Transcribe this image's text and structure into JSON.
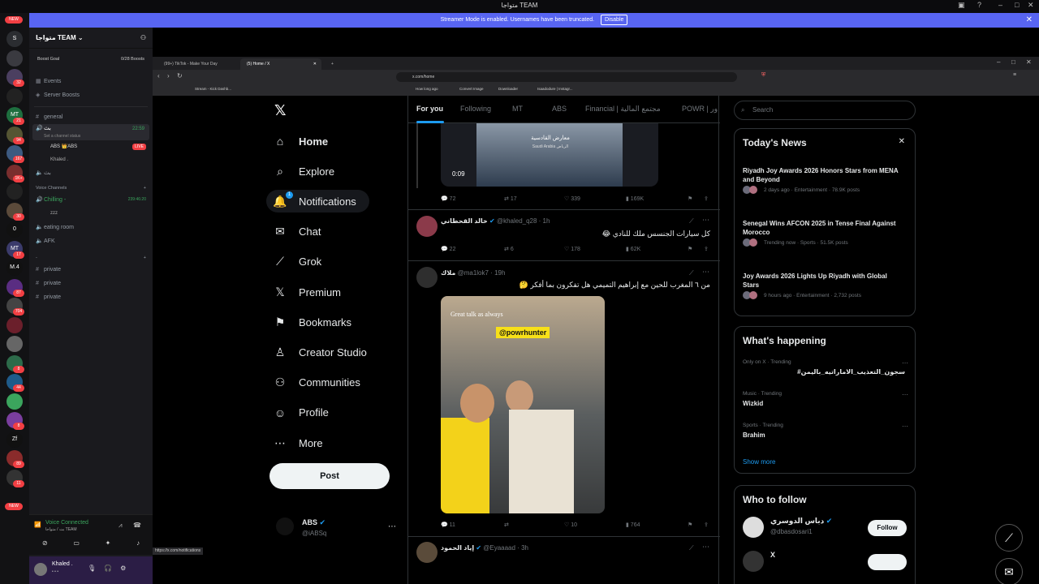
{
  "window": {
    "title": "متواجا TEAM"
  },
  "streamer_banner": {
    "text": "Streamer Mode is enabled. Usernames have been truncated.",
    "button": "Disable"
  },
  "rail": {
    "new_badge": "NEW",
    "items": [
      {
        "label": "S"
      },
      {
        "label": ""
      },
      {
        "label": "",
        "badge": "32"
      },
      {
        "label": ""
      },
      {
        "label": "MT",
        "badge": "21"
      },
      {
        "label": "",
        "badge": "94"
      },
      {
        "label": "",
        "badge": "167"
      },
      {
        "label": "",
        "badge": "1K+"
      },
      {
        "label": ""
      },
      {
        "label": "",
        "badge": "30"
      },
      {
        "label": "0"
      },
      {
        "label": "MT",
        "badge": "17"
      },
      {
        "label": "M.4"
      },
      {
        "label": "",
        "badge": "87"
      },
      {
        "label": "",
        "badge": "704"
      },
      {
        "label": ""
      },
      {
        "label": ""
      },
      {
        "label": "",
        "badge": "8"
      },
      {
        "label": "",
        "badge": "44"
      },
      {
        "label": ""
      },
      {
        "label": "",
        "badge": "8"
      },
      {
        "label": "Zf"
      },
      {
        "label": "",
        "badge": "89"
      },
      {
        "label": "",
        "badge": "11"
      }
    ],
    "new_badge_bottom": "NEW"
  },
  "discord": {
    "server_name": "متواجا TEAM",
    "boost_goal": "Boost Goal",
    "boost_count": "0/28 Boosts",
    "channels_top": [
      {
        "icon": "📅",
        "label": "Events"
      },
      {
        "icon": "◈",
        "label": "Server Boosts"
      }
    ],
    "general": "general",
    "voice_selected": {
      "label": "بث",
      "time": "22:59",
      "status": "Set a channel status"
    },
    "voice_users": [
      {
        "name": "ABS 👑ABS",
        "live": "LIVE"
      },
      {
        "name": "Khaled ."
      }
    ],
    "voice_other": "بث",
    "voice_category": "Voice Channels",
    "chilling": {
      "label": "Chilling -",
      "time": "239:46:20",
      "user": "zzz"
    },
    "eating": "eating room",
    "afk": "AFK",
    "private_category": "-",
    "privates": [
      "private",
      "private",
      "private"
    ],
    "voice_connected": "Voice Connected",
    "voice_sub": "بث / متواجا TEAM",
    "user_name": "Khaled .",
    "user_status": "• • •"
  },
  "browser": {
    "tabs": [
      {
        "label": "(99+) TikTok - Make Your Day"
      },
      {
        "label": "(5) Home / X"
      }
    ],
    "url": "x.com/home",
    "bookmarks": [
      "Stream - Kick Dashb...",
      "How long ago",
      "Convert Image",
      "Downloader",
      "Isaadodure | Instagr..."
    ],
    "status_url": "https://x.com/notifications"
  },
  "x": {
    "nav": [
      {
        "icon": "⌂",
        "label": "Home",
        "bold": true
      },
      {
        "icon": "⌕",
        "label": "Explore"
      },
      {
        "icon": "🔔",
        "label": "Notifications"
      },
      {
        "icon": "✉",
        "label": "Chat"
      },
      {
        "icon": "⟋",
        "label": "Grok"
      },
      {
        "icon": "𝕏",
        "label": "Premium"
      },
      {
        "icon": "⚑",
        "label": "Bookmarks"
      },
      {
        "icon": "♙",
        "label": "Creator Studio"
      },
      {
        "icon": "⚇",
        "label": "Communities"
      },
      {
        "icon": "☺",
        "label": "Profile"
      },
      {
        "icon": "⋯",
        "label": "More"
      }
    ],
    "notification_count": "1",
    "post_button": "Post",
    "account": {
      "name": "ABS",
      "handle": "@iABSq"
    },
    "feed_tabs": [
      "For you",
      "Following",
      "MT",
      "ABS",
      "Financial | مجتمع المالية",
      "POWR | ور"
    ],
    "video": {
      "time": "0:09",
      "overlay": "معارض القادسية",
      "location": "Saudi Arabia الرياض"
    },
    "tweet1_actions": {
      "reply": "72",
      "repost": "17",
      "like": "339",
      "views": "169K"
    },
    "tweet2": {
      "name": "خالد القحطاني",
      "handle": "@khaled_q28 · 1h",
      "text": "كل سيارات الجنسس ملك للنادي 😂",
      "reply": "22",
      "repost": "6",
      "like": "178",
      "views": "62K"
    },
    "tweet3": {
      "name": "ملاك",
      "handle": "@ma1lok7 · 19h",
      "text": "من ٦ المغرب للحين مع إبراهيم التميمي هل تفكرون بما أفكر 🤔",
      "image_caption": "Great talk as always",
      "image_tag": "@powrhunter",
      "reply": "11",
      "repost": "",
      "like": "10",
      "views": "764"
    },
    "tweet4": {
      "name": "إياد الحمود",
      "handle": "@Eyaaaad · 3h"
    },
    "search_placeholder": "Search",
    "todays_news": {
      "title": "Today's News",
      "items": [
        {
          "title": "Riyadh Joy Awards 2026 Honors Stars from MENA and Beyond",
          "meta": "2 days ago · Entertainment · 78.9K posts"
        },
        {
          "title": "Senegal Wins AFCON 2025 in Tense Final Against Morocco",
          "meta": "Trending now · Sports · 51.5K posts"
        },
        {
          "title": "Joy Awards 2026 Lights Up Riyadh with Global Stars",
          "meta": "9 hours ago · Entertainment · 2,732 posts"
        }
      ]
    },
    "whats_happening": {
      "title": "What's happening",
      "items": [
        {
          "category": "Only on X · Trending",
          "topic": "#سجون_التعذيب_الاماراتيه_باليمن"
        },
        {
          "category": "Music · Trending",
          "topic": "Wizkid"
        },
        {
          "category": "Sports · Trending",
          "topic": "Brahim"
        }
      ],
      "show_more": "Show more"
    },
    "who_to_follow": {
      "title": "Who to follow",
      "users": [
        {
          "name": "دباس الدوسري",
          "handle": "@dbasdosari1",
          "button": "Follow"
        },
        {
          "name": "X",
          "handle": "",
          "button": ""
        }
      ]
    }
  }
}
